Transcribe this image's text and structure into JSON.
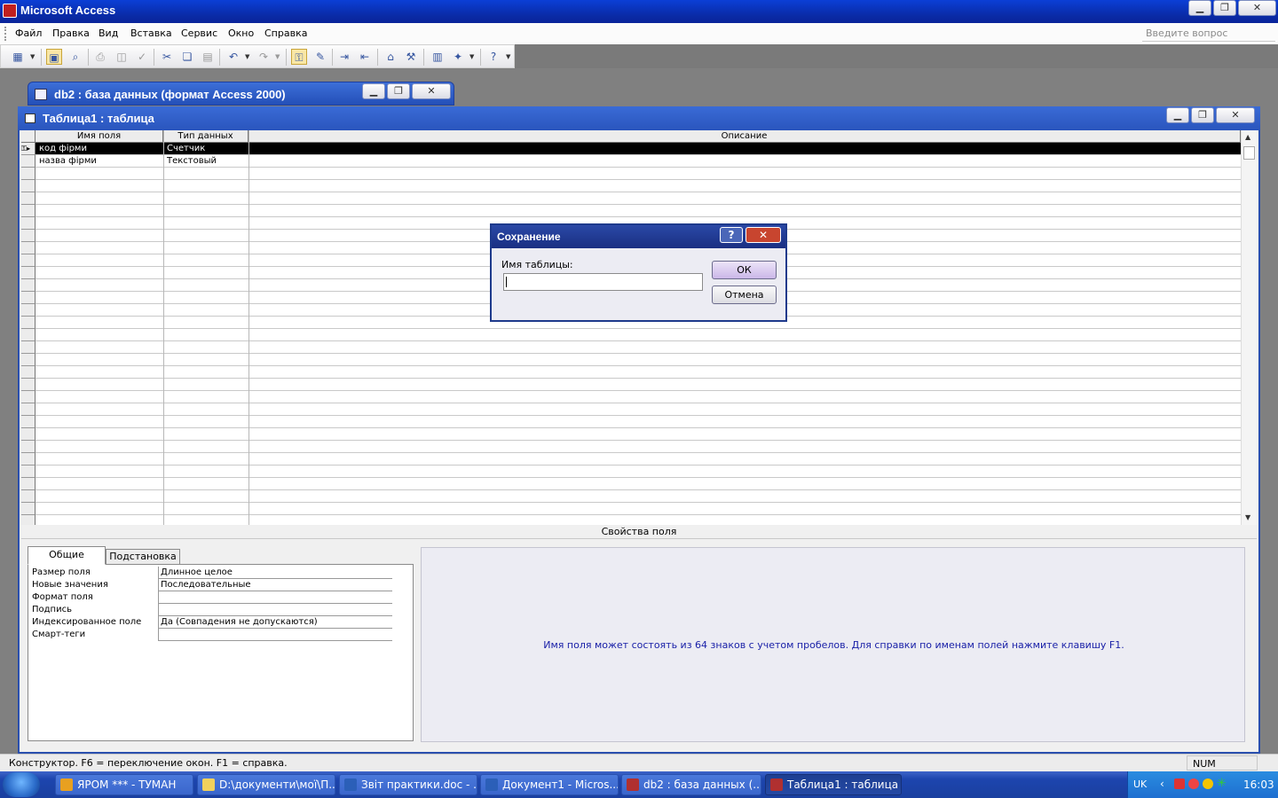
{
  "app": {
    "title": "Microsoft Access"
  },
  "menu": {
    "items": [
      "Файл",
      "Правка",
      "Вид",
      "Вставка",
      "Сервис",
      "Окно",
      "Справка"
    ],
    "help_placeholder": "Введите вопрос"
  },
  "db_window": {
    "title": "db2 : база данных (формат Access 2000)"
  },
  "table_window": {
    "title": "Таблица1 : таблица"
  },
  "grid": {
    "columns": [
      "Имя поля",
      "Тип данных",
      "Описание"
    ],
    "rows": [
      {
        "name": "код фірми",
        "type": "Счетчик",
        "desc": "",
        "primary_key": true
      },
      {
        "name": "назва фірми",
        "type": "Текстовый",
        "desc": ""
      }
    ]
  },
  "properties": {
    "header": "Свойства поля",
    "tabs": [
      "Общие",
      "Подстановка"
    ],
    "active_tab": "Общие",
    "rows": [
      {
        "name": "Размер поля",
        "value": "Длинное целое"
      },
      {
        "name": "Новые значения",
        "value": "Последовательные"
      },
      {
        "name": "Формат поля",
        "value": ""
      },
      {
        "name": "Подпись",
        "value": ""
      },
      {
        "name": "Индексированное поле",
        "value": "Да (Совпадения не допускаются)"
      },
      {
        "name": "Смарт-теги",
        "value": ""
      }
    ],
    "hint": "Имя поля может состоять из 64 знаков с учетом пробелов.  Для справки по именам полей нажмите клавишу F1."
  },
  "dialog": {
    "title": "Сохранение",
    "label": "Имя таблицы:",
    "value": "",
    "ok": "ОК",
    "cancel": "Отмена",
    "help_icon": "?",
    "close_icon": "✕"
  },
  "status": {
    "text": "Конструктор.  F6 = переключение окон.  F1 = справка.",
    "num": "NUM"
  },
  "taskbar": {
    "tasks": [
      {
        "label": "ЯРОМ *** - ТУМАН",
        "icon_color": "#e8a020"
      },
      {
        "label": "D:\\документи\\мої\\П...",
        "icon_color": "#f2d15c"
      },
      {
        "label": "Звіт практики.doc - ...",
        "icon_color": "#2b5fb8"
      },
      {
        "label": "Документ1 - Micros...",
        "icon_color": "#2b5fb8"
      },
      {
        "label": "db2 : база данных (...",
        "icon_color": "#b03030"
      },
      {
        "label": "Таблица1 : таблица",
        "icon_color": "#b03030",
        "active": true
      }
    ],
    "lang": "UK",
    "clock": "16:03"
  },
  "colors": {
    "title_blue": "#0a2aa5",
    "hint_text": "#1a21a8",
    "dialog_ok": "#d9c8ee"
  }
}
